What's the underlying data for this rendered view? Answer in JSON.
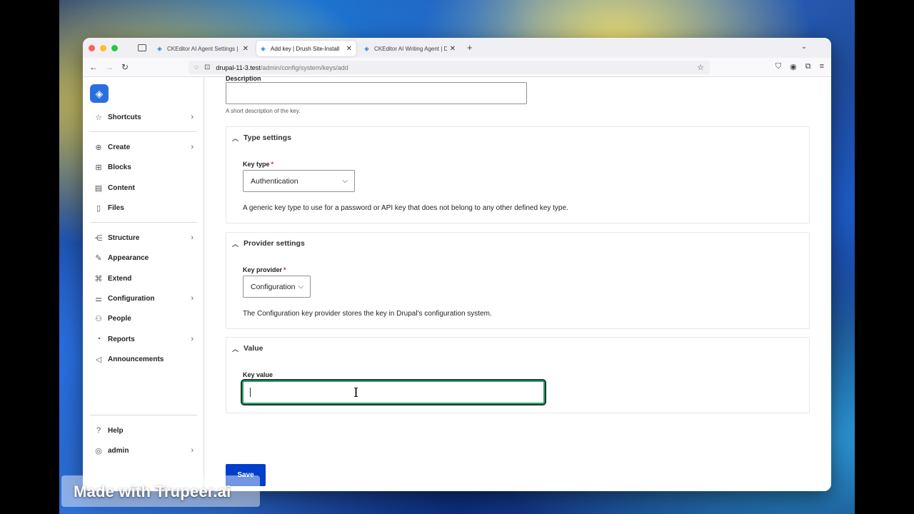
{
  "browser": {
    "tabs": [
      {
        "label": "CKEditor AI Agent Settings | Drus",
        "active": false
      },
      {
        "label": "Add key | Drush Site-Install",
        "active": true
      },
      {
        "label": "CKEditor AI Writing Agent | Drup",
        "active": false
      }
    ],
    "url_host": "drupal-11-3.test",
    "url_path": "/admin/config/system/keys/add"
  },
  "sidebar": {
    "items": [
      {
        "label": "Shortcuts",
        "icon": "star-icon",
        "has_children": true
      },
      {
        "label": "Create",
        "icon": "plus-circle-icon",
        "has_children": true
      },
      {
        "label": "Blocks",
        "icon": "grid-icon",
        "has_children": false
      },
      {
        "label": "Content",
        "icon": "document-icon",
        "has_children": false
      },
      {
        "label": "Files",
        "icon": "file-icon",
        "has_children": false
      },
      {
        "label": "Structure",
        "icon": "sitemap-icon",
        "has_children": true
      },
      {
        "label": "Appearance",
        "icon": "brush-icon",
        "has_children": false
      },
      {
        "label": "Extend",
        "icon": "puzzle-icon",
        "has_children": false
      },
      {
        "label": "Configuration",
        "icon": "sliders-icon",
        "has_children": true
      },
      {
        "label": "People",
        "icon": "person-icon",
        "has_children": false
      },
      {
        "label": "Reports",
        "icon": "chart-icon",
        "has_children": true
      },
      {
        "label": "Announcements",
        "icon": "megaphone-icon",
        "has_children": false
      }
    ],
    "footer": [
      {
        "label": "Help",
        "icon": "help-icon",
        "has_children": false
      },
      {
        "label": "admin",
        "icon": "user-icon",
        "has_children": true
      }
    ]
  },
  "form": {
    "description_label": "Description",
    "description_value": "",
    "description_help": "A short description of the key.",
    "type_settings": {
      "title": "Type settings",
      "key_type_label": "Key type",
      "key_type_value": "Authentication",
      "key_type_desc": "A generic key type to use for a password or API key that does not belong to any other defined key type."
    },
    "provider_settings": {
      "title": "Provider settings",
      "key_provider_label": "Key provider",
      "key_provider_value": "Configuration",
      "key_provider_desc": "The Configuration key provider stores the key in Drupal's configuration system."
    },
    "value": {
      "title": "Value",
      "key_value_label": "Key value",
      "key_value": ""
    },
    "required_marker": "*",
    "save_label": "Save"
  },
  "watermark": "Made with Trupeer.ai",
  "colors": {
    "accent": "#003ecc",
    "focus": "#26a769",
    "required": "#dc2323",
    "logo": "#2a6fe0"
  }
}
